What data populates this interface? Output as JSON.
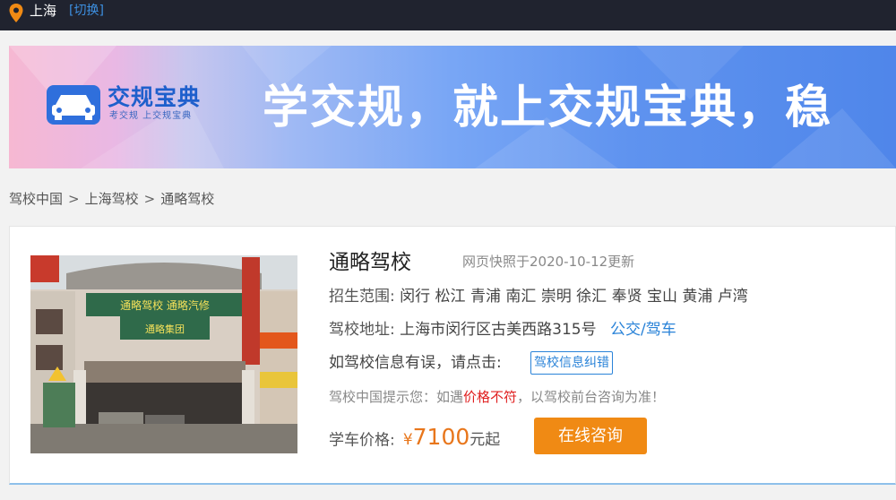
{
  "topbar": {
    "location_icon": "map-pin-icon",
    "city": "上海",
    "switch_label": "[切换]"
  },
  "banner": {
    "brand_name": "交规宝典",
    "brand_slogan": "考交规 上交规宝典",
    "headline": "学交规，就上交规宝典，稳",
    "logo_icon": "car-icon"
  },
  "breadcrumb": {
    "items": [
      "驾校中国",
      "上海驾校",
      "通略驾校"
    ],
    "separator": ">"
  },
  "school": {
    "name": "通略驾校",
    "snapshot_note": "网页快照于2020-10-12更新",
    "range_label": "招生范围:",
    "range_value": "闵行 松江 青浦 南汇 崇明 徐汇 奉贤 宝山 黄浦 卢湾",
    "address_label": "驾校地址:",
    "address_value": "上海市闵行区古美西路315号",
    "address_link": "公交/驾车",
    "error_prompt": "如驾校信息有误，请点击:",
    "error_button": "驾校信息纠错",
    "tip_prefix": "驾校中国提示您：如遇",
    "tip_highlight": "价格不符",
    "tip_suffix": "，以驾校前台咨询为准！",
    "price_label": "学车价格:",
    "price_currency": "¥",
    "price_amount": "7100",
    "price_suffix": "元起",
    "consult_button": "在线咨询",
    "photo_sign_text": "通略驾校 通略汽修",
    "photo_sign_sub": "通略集团"
  },
  "colors": {
    "topbar_bg": "#20232f",
    "link_blue": "#2a83d8",
    "price_orange": "#e8761b",
    "button_orange": "#f08a14",
    "warning_red": "#e02020"
  }
}
